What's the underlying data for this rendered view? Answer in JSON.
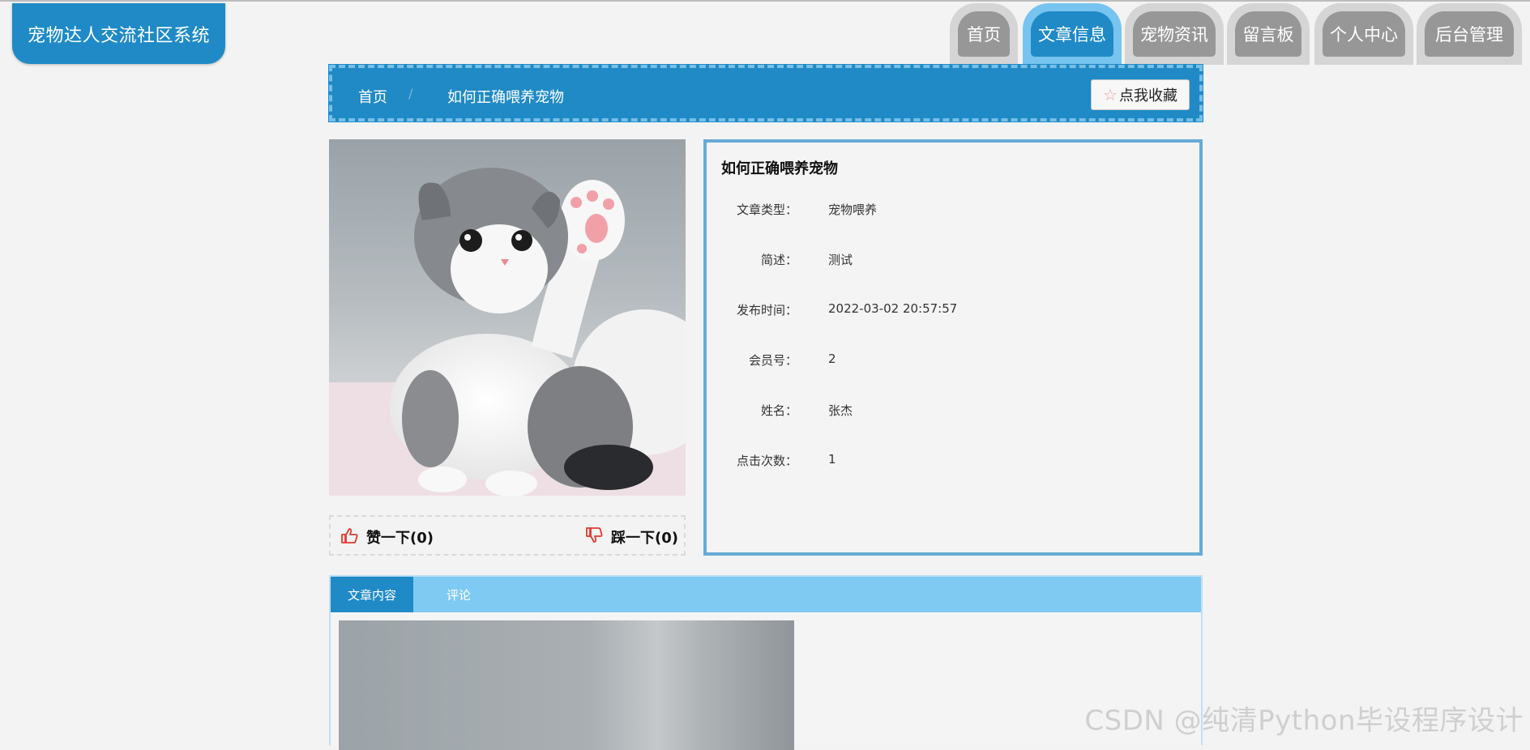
{
  "logo": {
    "text": "宠物达人交流社区系统"
  },
  "nav": [
    {
      "label": "首页",
      "active": false
    },
    {
      "label": "文章信息",
      "active": true
    },
    {
      "label": "宠物资讯",
      "active": false
    },
    {
      "label": "留言板",
      "active": false
    },
    {
      "label": "个人中心",
      "active": false
    },
    {
      "label": "后台管理",
      "active": false
    }
  ],
  "breadcrumb": {
    "home": "首页",
    "separator": "/",
    "current": "如何正确喂养宠物"
  },
  "favorite": {
    "label": "点我收藏",
    "icon": "star-icon"
  },
  "image": {
    "subject": "kitten-photo"
  },
  "votes": {
    "like_label": "赞一下(0)",
    "like_icon": "thumbs-up-icon",
    "dislike_label": "踩一下(0)",
    "dislike_icon": "thumbs-down-icon"
  },
  "detail": {
    "title": "如何正确喂养宠物",
    "rows": [
      {
        "label": "文章类型：",
        "value": "宠物喂养"
      },
      {
        "label": "简述：",
        "value": "测试"
      },
      {
        "label": "发布时间：",
        "value": "2022-03-02 20:57:57"
      },
      {
        "label": "会员号：",
        "value": "2"
      },
      {
        "label": "姓名：",
        "value": "张杰"
      },
      {
        "label": "点击次数：",
        "value": "1"
      }
    ]
  },
  "tabs": [
    {
      "label": "文章内容",
      "active": true
    },
    {
      "label": "评论",
      "active": false
    }
  ],
  "watermark": "CSDN @纯清Python毕设程序设计",
  "colors": {
    "primary": "#1f8ac6",
    "light": "#7fcaf3",
    "inactive_tab": "#979797"
  }
}
